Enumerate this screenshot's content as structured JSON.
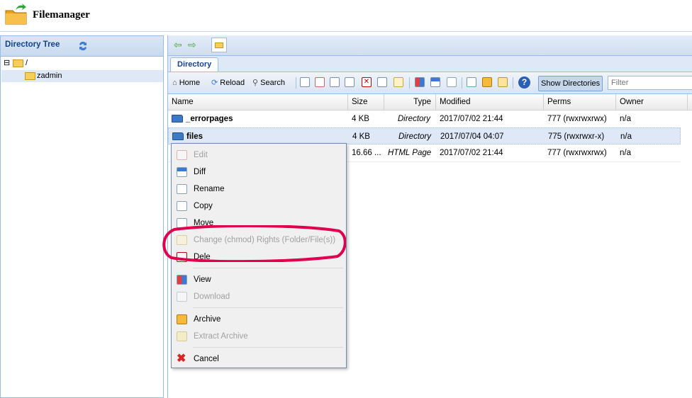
{
  "app": {
    "title": "Filemanager"
  },
  "tree": {
    "title": "Directory Tree",
    "nodes": [
      {
        "label": "/",
        "expand": "⊟"
      },
      {
        "label": "zadmin"
      }
    ]
  },
  "main": {
    "tab": "Directory",
    "toolbar": {
      "home": "Home",
      "reload": "Reload",
      "search": "Search",
      "show_directories": "Show Directories",
      "filter_placeholder": "Filter"
    },
    "columns": [
      "Name",
      "Size",
      "Type",
      "Modified",
      "Perms",
      "Owner"
    ],
    "rows": [
      {
        "name": "_errorpages",
        "size": "4 KB",
        "type": "Directory",
        "modified": "2017/07/02 21:44",
        "perms": "777 (rwxrwxrwx)",
        "owner": "n/a"
      },
      {
        "name": "files",
        "size": "4 KB",
        "type": "Directory",
        "modified": "2017/07/04 04:07",
        "perms": "775 (rwxrwxr-x)",
        "owner": "n/a"
      },
      {
        "name": "",
        "size": "16.66 ...",
        "type": "HTML Page",
        "modified": "2017/07/02 21:44",
        "perms": "777 (rwxrwxrwx)",
        "owner": "n/a"
      }
    ]
  },
  "context_menu": {
    "items": [
      {
        "label": "Edit",
        "icon": "edit-icon"
      },
      {
        "label": "Diff",
        "icon": "diff-icon"
      },
      {
        "label": "Rename",
        "icon": "rename-icon"
      },
      {
        "label": "Copy",
        "icon": "copy-icon"
      },
      {
        "label": "Move",
        "icon": "move-icon"
      },
      {
        "label": "Change (chmod) Rights (Folder/File(s))",
        "icon": "chmod-icon"
      },
      {
        "label": "Dele",
        "icon": "delete-icon"
      },
      {
        "label": "View",
        "icon": "view-icon"
      },
      {
        "label": "Download",
        "icon": "download-icon"
      },
      {
        "label": "Archive",
        "icon": "archive-icon"
      },
      {
        "label": "Extract Archive",
        "icon": "extract-icon"
      },
      {
        "label": "Cancel",
        "icon": "cancel-icon"
      }
    ]
  },
  "colors": {
    "accent": "#15428b",
    "selection": "#dfe8f6",
    "annotation": "#e0004d"
  }
}
